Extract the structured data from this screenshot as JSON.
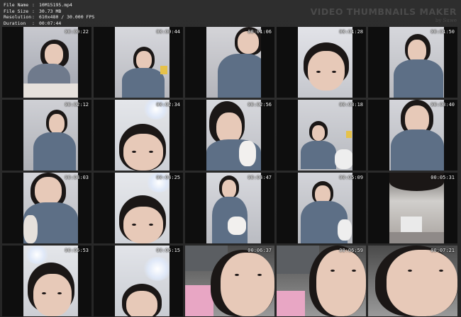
{
  "info": {
    "file_name_label": "File Name",
    "file_name": "10M15195.mp4",
    "file_size_label": "File Size",
    "file_size": "30.73 MB",
    "resolution_label": "Resolution",
    "resolution": "610x480 / 30.000 FPS",
    "duration_label": "Duration",
    "duration": "00:07:44",
    "separator": ":"
  },
  "brand": {
    "title": "VIDEO THUMBNAILS MAKER",
    "subtitle": "by Suwe"
  },
  "thumbnails": [
    {
      "time": "00:00:22"
    },
    {
      "time": "00:00:44"
    },
    {
      "time": "00:01:06"
    },
    {
      "time": "00:01:28"
    },
    {
      "time": "00:01:50"
    },
    {
      "time": "00:02:12"
    },
    {
      "time": "00:02:34"
    },
    {
      "time": "00:02:56"
    },
    {
      "time": "00:03:18"
    },
    {
      "time": "00:03:40"
    },
    {
      "time": "00:04:03"
    },
    {
      "time": "00:04:25"
    },
    {
      "time": "00:04:47"
    },
    {
      "time": "00:05:09"
    },
    {
      "time": "00:05:31"
    },
    {
      "time": "00:05:53"
    },
    {
      "time": "00:06:15"
    },
    {
      "time": "00:06:37"
    },
    {
      "time": "00:06:59"
    },
    {
      "time": "00:07:21"
    }
  ]
}
